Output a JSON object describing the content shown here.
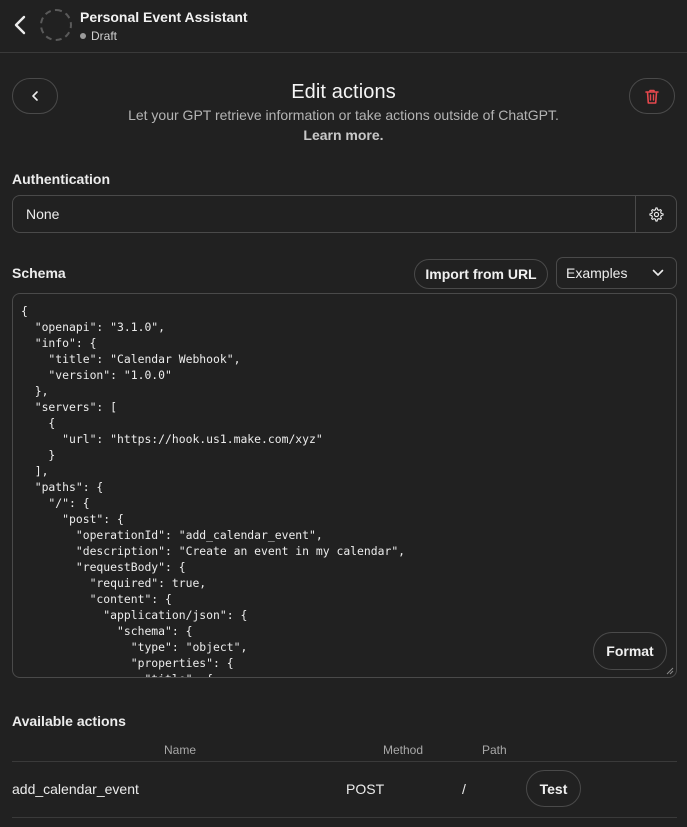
{
  "header": {
    "gpt_name": "Personal Event Assistant",
    "status": "Draft"
  },
  "page": {
    "title": "Edit actions",
    "subtitle": "Let your GPT retrieve information or take actions outside of ChatGPT.",
    "learn_more": "Learn more."
  },
  "authentication": {
    "label": "Authentication",
    "value": "None"
  },
  "schema": {
    "label": "Schema",
    "import_button": "Import from URL",
    "examples_select": "Examples",
    "format_button": "Format",
    "code": "{\n  \"openapi\": \"3.1.0\",\n  \"info\": {\n    \"title\": \"Calendar Webhook\",\n    \"version\": \"1.0.0\"\n  },\n  \"servers\": [\n    {\n      \"url\": \"https://hook.us1.make.com/xyz\"\n    }\n  ],\n  \"paths\": {\n    \"/\": {\n      \"post\": {\n        \"operationId\": \"add_calendar_event\",\n        \"description\": \"Create an event in my calendar\",\n        \"requestBody\": {\n          \"required\": true,\n          \"content\": {\n            \"application/json\": {\n              \"schema\": {\n                \"type\": \"object\",\n                \"properties\": {\n                  \"title\": {"
  },
  "available_actions": {
    "label": "Available actions",
    "columns": [
      "Name",
      "Method",
      "Path"
    ],
    "rows": [
      {
        "name": "add_calendar_event",
        "method": "POST",
        "path": "/",
        "test_label": "Test"
      }
    ]
  },
  "icons": {
    "back_top": "chevron-left-icon",
    "back_button": "chevron-left-icon",
    "delete": "trash-icon",
    "auth_settings": "gear-icon",
    "examples_dropdown": "chevron-down-icon"
  },
  "colors": {
    "background": "#212121",
    "border": "#4a4a4a",
    "delete_red": "#e5484d"
  }
}
